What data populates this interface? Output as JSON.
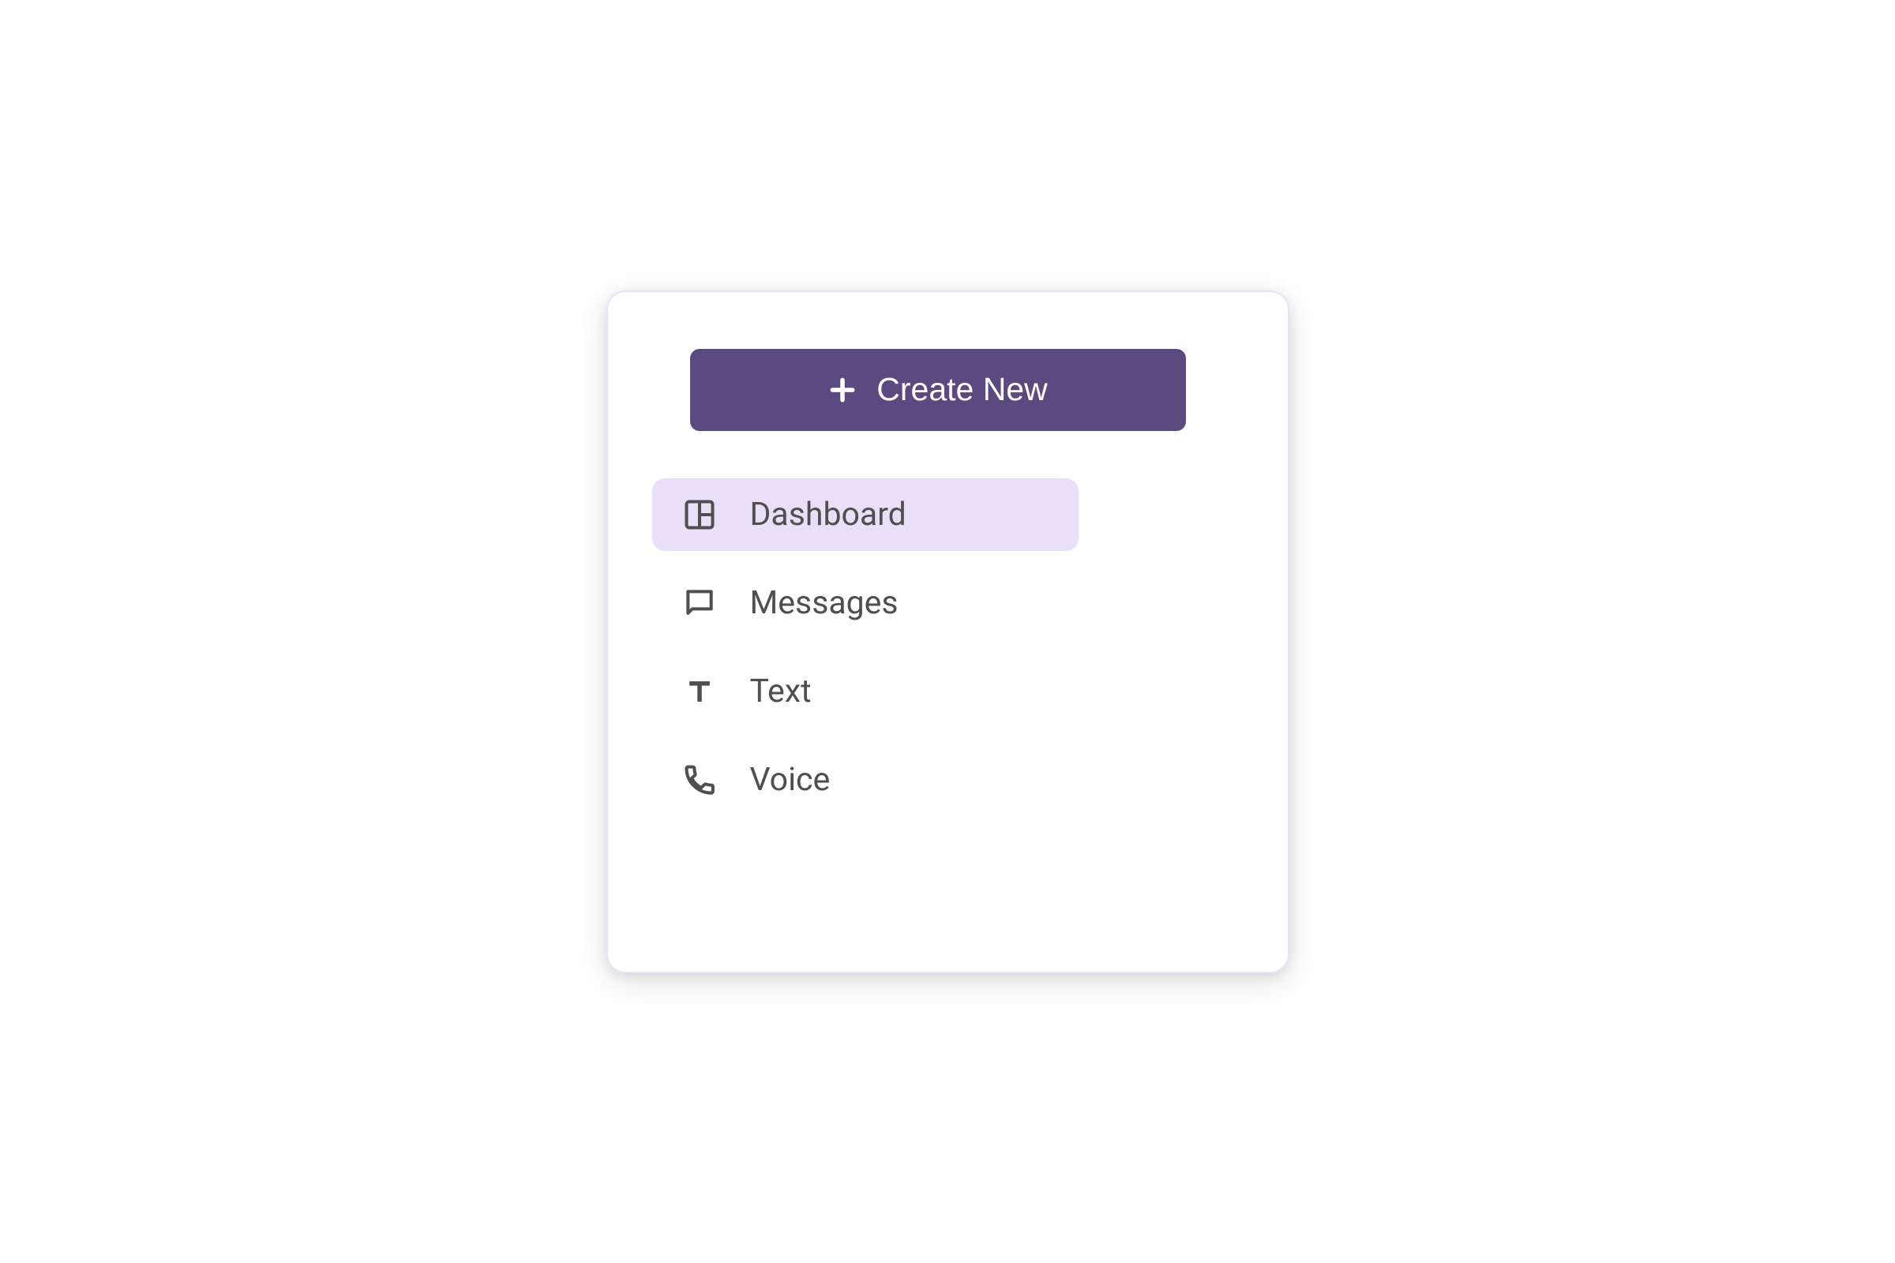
{
  "create_button": {
    "label": "Create New"
  },
  "nav": {
    "items": [
      {
        "label": "Dashboard",
        "active": true
      },
      {
        "label": "Messages",
        "active": false
      },
      {
        "label": "Text",
        "active": false
      },
      {
        "label": "Voice",
        "active": false
      }
    ]
  },
  "colors": {
    "accent": "#5b4a80",
    "active_bg": "#e9dff8",
    "text": "#4f4f4f",
    "border": "#eae3f7"
  }
}
